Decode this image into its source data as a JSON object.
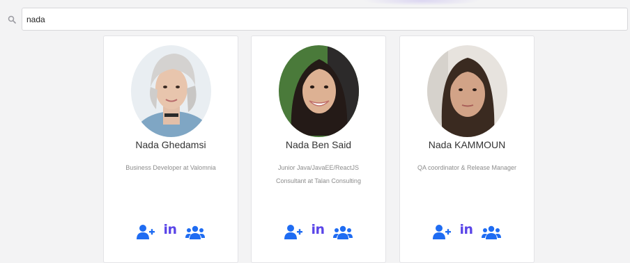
{
  "search": {
    "value": "nada",
    "icon": "search-icon"
  },
  "colors": {
    "accent": "#1f6cf2",
    "linkedin": "#5a45e8",
    "background": "#f3f3f4"
  },
  "profiles": [
    {
      "name": "Nada Ghedamsi",
      "title": "Business Developer at Valomnia",
      "actions": [
        "add-user-icon",
        "linkedin-icon",
        "group-icon"
      ],
      "linkedin_label": "in"
    },
    {
      "name": "Nada Ben Said",
      "title": "Junior Java/JavaEE/ReactJS Consultant at Talan Consulting",
      "actions": [
        "add-user-icon",
        "linkedin-icon",
        "group-icon"
      ],
      "linkedin_label": "in"
    },
    {
      "name": "Nada KAMMOUN",
      "title": "QA coordinator & Release Manager",
      "actions": [
        "add-user-icon",
        "linkedin-icon",
        "group-icon"
      ],
      "linkedin_label": "in"
    }
  ]
}
